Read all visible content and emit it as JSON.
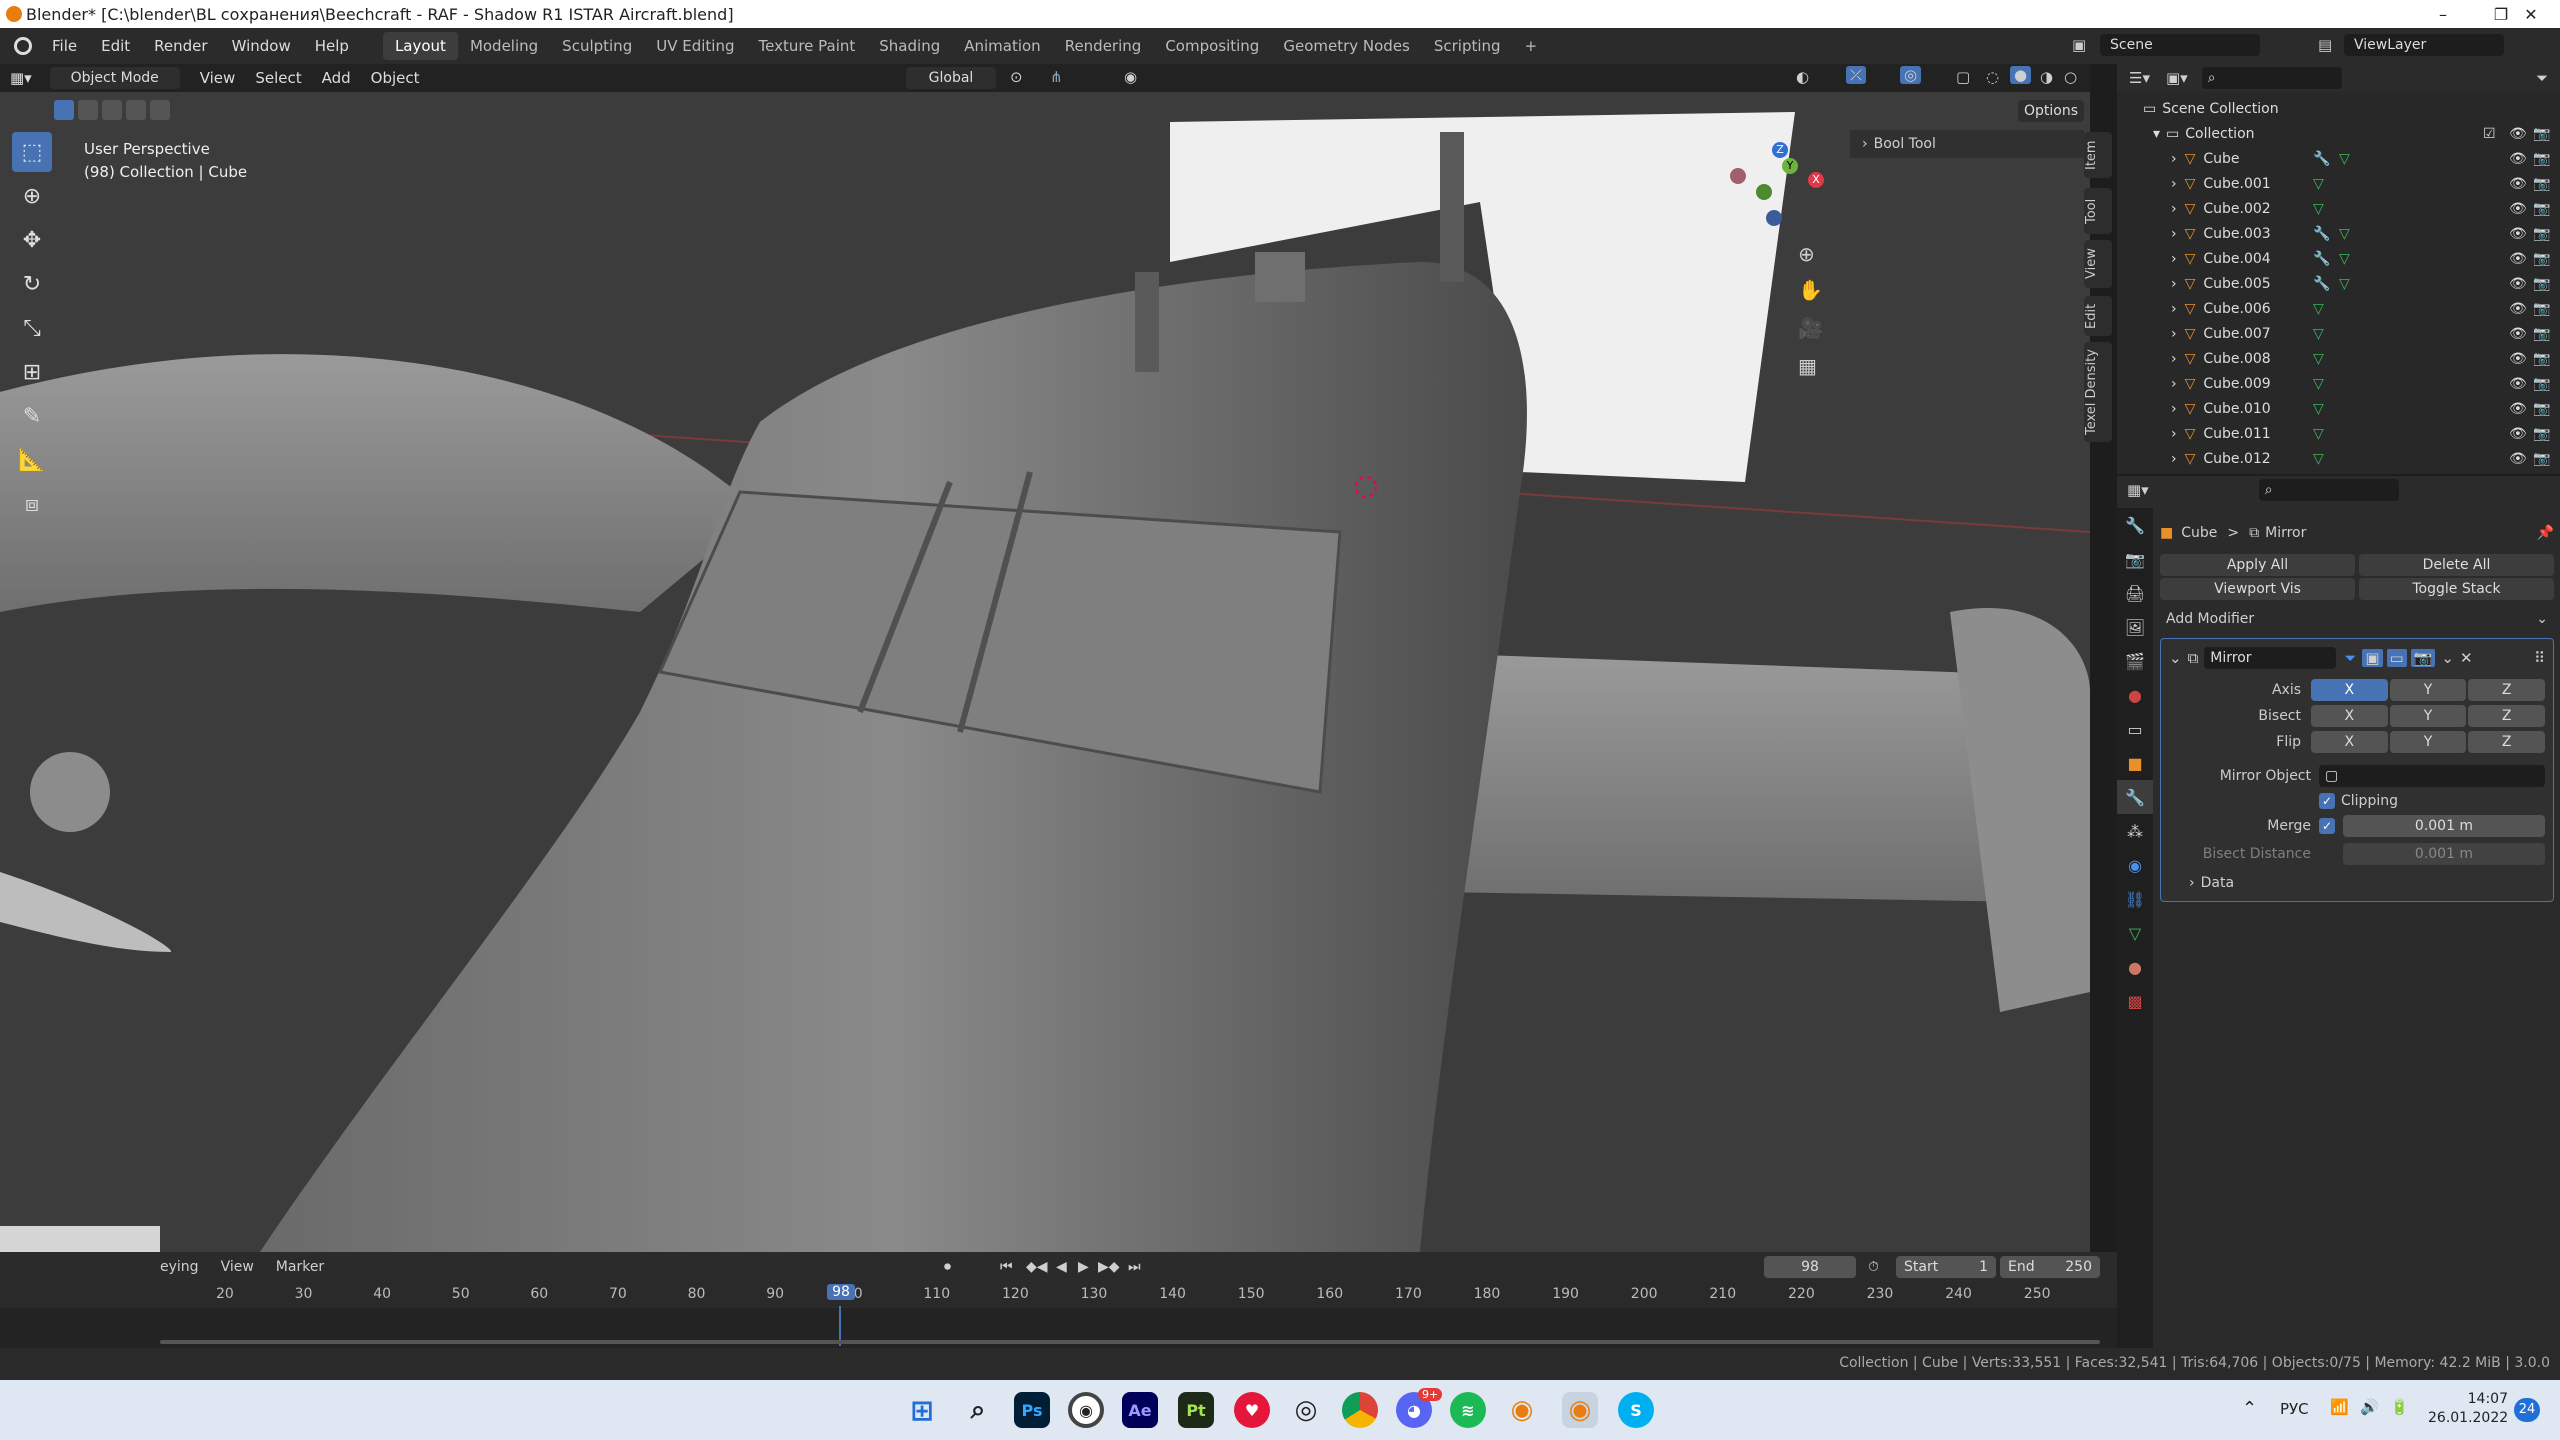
{
  "window": {
    "title": "Blender* [C:\\blender\\BL сохранения\\Beechcraft - RAF - Shadow R1 ISTAR Aircraft.blend]",
    "minimize": "–",
    "maximize": "❐",
    "close": "✕"
  },
  "menu": [
    "File",
    "Edit",
    "Render",
    "Window",
    "Help"
  ],
  "workspaces": [
    "Layout",
    "Modeling",
    "Sculpting",
    "UV Editing",
    "Texture Paint",
    "Shading",
    "Animation",
    "Rendering",
    "Compositing",
    "Geometry Nodes",
    "Scripting"
  ],
  "workspace_add": "+",
  "scene": {
    "label": "Scene",
    "viewlayer": "ViewLayer"
  },
  "viewport_header": {
    "mode": "Object Mode",
    "items": [
      "View",
      "Select",
      "Add",
      "Object"
    ],
    "orientation": "Global",
    "options": "Options"
  },
  "viewport": {
    "perspective": "User Perspective",
    "collection_info": "(98) Collection | Cube",
    "bool_tool": "Bool Tool"
  },
  "side_tabs": [
    "Item",
    "Tool",
    "View",
    "Edit",
    "Texel Density"
  ],
  "gizmo": {
    "z": "Z",
    "y": "Y",
    "x": "X"
  },
  "outliner": {
    "root": "Scene Collection",
    "collection": "Collection",
    "objects": [
      "Cube",
      "Cube.001",
      "Cube.002",
      "Cube.003",
      "Cube.004",
      "Cube.005",
      "Cube.006",
      "Cube.007",
      "Cube.008",
      "Cube.009",
      "Cube.010",
      "Cube.011",
      "Cube.012"
    ]
  },
  "properties": {
    "breadcrumb_obj": "Cube",
    "breadcrumb_sep": ">",
    "breadcrumb_mod": "Mirror",
    "apply_all": "Apply All",
    "delete_all": "Delete All",
    "viewport_vis": "Viewport Vis",
    "toggle_stack": "Toggle Stack",
    "add_modifier": "Add Modifier",
    "modifier": {
      "name": "Mirror",
      "axis_label": "Axis",
      "bisect_label": "Bisect",
      "flip_label": "Flip",
      "x": "X",
      "y": "Y",
      "z": "Z",
      "mirror_object_label": "Mirror Object",
      "clipping": "Clipping",
      "merge_label": "Merge",
      "merge_value": "0.001 m",
      "bisect_distance_label": "Bisect Distance",
      "bisect_distance_value": "0.001 m",
      "data_label": "Data"
    }
  },
  "timeline": {
    "menu": [
      "eying",
      "View",
      "Marker"
    ],
    "current_frame": "98",
    "start_label": "Start",
    "start": "1",
    "end_label": "End",
    "end": "250",
    "ticks": [
      "20",
      "30",
      "40",
      "50",
      "60",
      "70",
      "80",
      "90",
      "00",
      "110",
      "120",
      "130",
      "140",
      "150",
      "160",
      "170",
      "180",
      "190",
      "200",
      "210",
      "220",
      "230",
      "240",
      "250"
    ],
    "playhead": "98"
  },
  "status": {
    "text": "Collection | Cube | Verts:33,551 | Faces:32,541 | Tris:64,706 | Objects:0/75 | Memory: 42.2 MiB | 3.0.0"
  },
  "taskbar": {
    "lang": "РУС",
    "time": "14:07",
    "date": "26.01.2022",
    "notif": "24",
    "discord_badge": "9+",
    "apps": [
      "ps-icon",
      "chrome-icon",
      "ae-icon",
      "pt-icon",
      "red-app-icon",
      "github-icon",
      "chrome-browser-icon",
      "discord-icon",
      "spotify-icon",
      "blender-icon",
      "blender-active-icon",
      "skype-icon"
    ],
    "app_labels": {
      "ps": "Ps",
      "ae": "Ae",
      "pt": "Pt",
      "skype": "S"
    }
  },
  "colors": {
    "accent": "#4772b3",
    "viewport_bg": "#3c3c3c",
    "header": "#2b2b2b"
  }
}
